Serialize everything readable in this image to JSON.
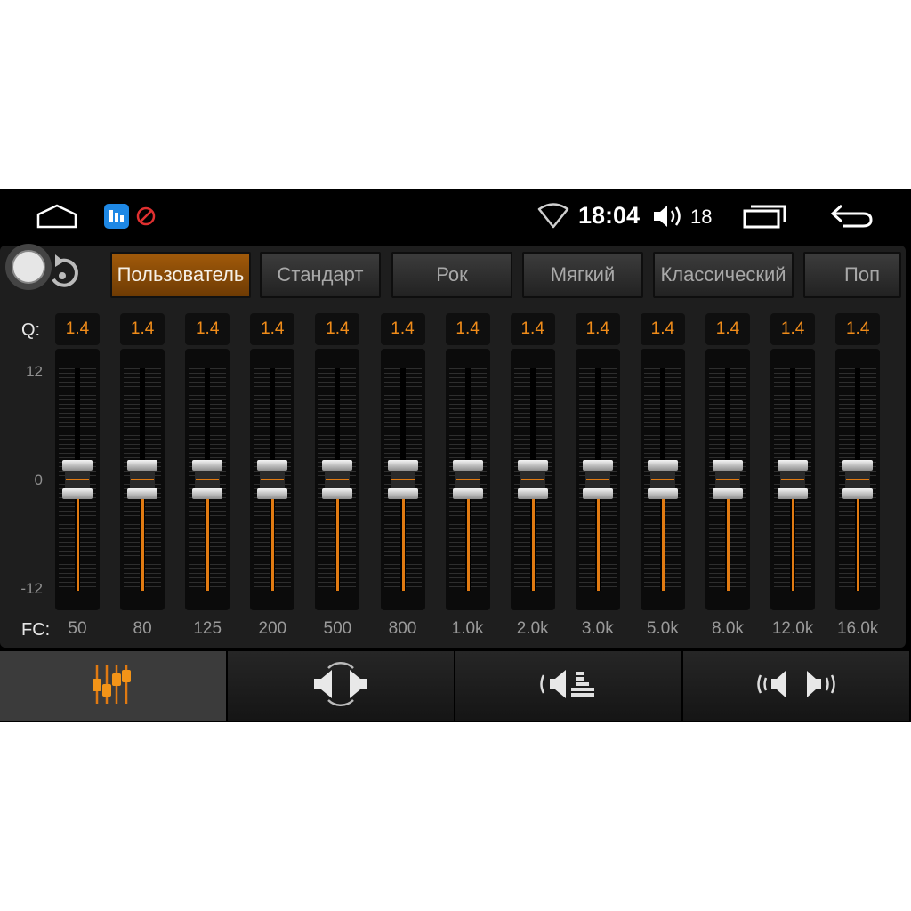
{
  "status_bar": {
    "time": "18:04",
    "volume_level": "18",
    "icons": [
      "home-icon",
      "app-notification-icon",
      "no-entry-icon",
      "wifi-icon",
      "volume-icon",
      "recent-apps-icon",
      "back-icon"
    ]
  },
  "presets": [
    {
      "label": "Пользователь",
      "active": true
    },
    {
      "label": "Стандарт",
      "active": false
    },
    {
      "label": "Рок",
      "active": false
    },
    {
      "label": "Мягкий",
      "active": false
    },
    {
      "label": "Классический",
      "active": false
    },
    {
      "label": "Поп",
      "active": false
    }
  ],
  "labels": {
    "q": "Q:",
    "fc": "FC:"
  },
  "scale": {
    "max": "12",
    "zero": "0",
    "min": "-12"
  },
  "bands": [
    {
      "q": "1.4",
      "fc": "50",
      "gain_db": 0
    },
    {
      "q": "1.4",
      "fc": "80",
      "gain_db": 0
    },
    {
      "q": "1.4",
      "fc": "125",
      "gain_db": 0
    },
    {
      "q": "1.4",
      "fc": "200",
      "gain_db": 0
    },
    {
      "q": "1.4",
      "fc": "500",
      "gain_db": 0
    },
    {
      "q": "1.4",
      "fc": "800",
      "gain_db": 0
    },
    {
      "q": "1.4",
      "fc": "1.0k",
      "gain_db": 0
    },
    {
      "q": "1.4",
      "fc": "2.0k",
      "gain_db": 0
    },
    {
      "q": "1.4",
      "fc": "3.0k",
      "gain_db": 0
    },
    {
      "q": "1.4",
      "fc": "5.0k",
      "gain_db": 0
    },
    {
      "q": "1.4",
      "fc": "8.0k",
      "gain_db": 0
    },
    {
      "q": "1.4",
      "fc": "12.0k",
      "gain_db": 0
    },
    {
      "q": "1.4",
      "fc": "16.0k",
      "gain_db": 0
    }
  ],
  "bottom_tabs": [
    {
      "icon": "equalizer-sliders-icon",
      "active": true
    },
    {
      "icon": "speaker-balance-icon",
      "active": false
    },
    {
      "icon": "bass-boost-icon",
      "active": false
    },
    {
      "icon": "surround-sound-icon",
      "active": false
    }
  ],
  "colors": {
    "accent": "#e07a12",
    "q_text": "#f08c1a",
    "active_preset": "#8a4a08"
  }
}
